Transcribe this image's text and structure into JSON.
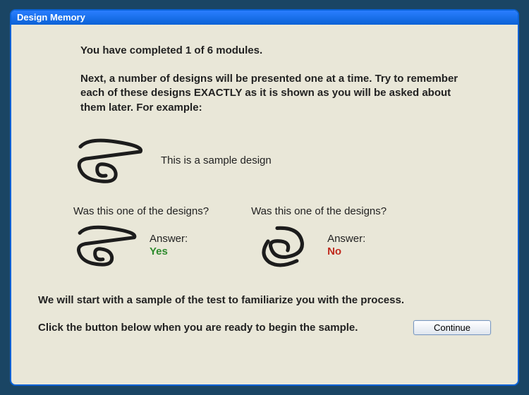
{
  "window": {
    "title": "Design Memory"
  },
  "intro": {
    "progress": "You have completed 1 of 6 modules.",
    "instructions": "Next, a number of designs will be presented one at a time. Try to remember each of these designs EXACTLY as it is shown as you will be asked about them later. For example:"
  },
  "sample": {
    "label": "This is a sample design"
  },
  "qa": {
    "left": {
      "question": "Was this one of the designs?",
      "answer_label": "Answer:",
      "answer": "Yes"
    },
    "right": {
      "question": "Was this one of the designs?",
      "answer_label": "Answer:",
      "answer": "No"
    }
  },
  "footer": {
    "line1": "We will start with a sample of the test to familiarize you with the process.",
    "line2": "Click the button below when you are ready to begin the sample.",
    "continue_label": "Continue"
  }
}
